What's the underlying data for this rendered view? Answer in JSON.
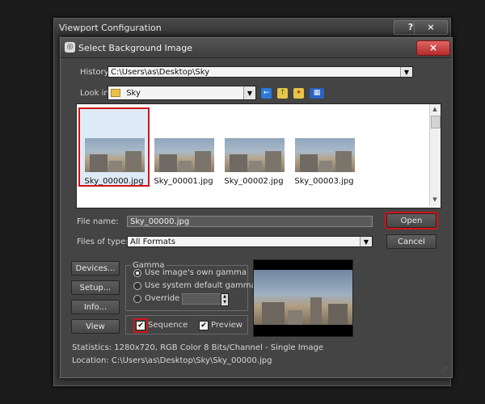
{
  "outer_window": {
    "title": "Viewport Configuration",
    "help_label": "?",
    "close_label": "×"
  },
  "dialog": {
    "title": "Select Background Image",
    "close_label": "×",
    "history_label": "History:",
    "history_value": "C:\\Users\\as\\Desktop\\Sky",
    "lookin_label": "Look in:",
    "lookin_value": "Sky",
    "files": [
      {
        "name": "Sky_00000.jpg",
        "selected": true
      },
      {
        "name": "Sky_00001.jpg",
        "selected": false
      },
      {
        "name": "Sky_00002.jpg",
        "selected": false
      },
      {
        "name": "Sky_00003.jpg",
        "selected": false
      }
    ],
    "filename_label": "File name:",
    "filename_value": "Sky_00000.jpg",
    "filetype_label": "Files of type:",
    "filetype_value": "All Formats",
    "open_label": "Open",
    "cancel_label": "Cancel",
    "devices_label": "Devices...",
    "setup_label": "Setup...",
    "info_label": "Info...",
    "view_label": "View",
    "gamma": {
      "legend": "Gamma",
      "option_own": "Use image's own gamma",
      "option_default": "Use system default gamma",
      "option_override": "Override",
      "selected": "own"
    },
    "sequence_label": "Sequence",
    "sequence_checked": true,
    "preview_label": "Preview",
    "preview_checked": true,
    "statistics": "Statistics:  1280x720, RGB Color 8 Bits/Channel - Single Image",
    "location": "Location:  C:\\Users\\as\\Desktop\\Sky\\Sky_00000.jpg"
  },
  "colors": {
    "highlight_red": "#d0141a",
    "close_red": "#c53b3b",
    "dialog_bg": "#444444"
  },
  "icons": [
    "folder-icon",
    "back-icon",
    "up-folder-icon",
    "new-folder-icon",
    "view-menu-icon",
    "combo-arrow-icon"
  ]
}
